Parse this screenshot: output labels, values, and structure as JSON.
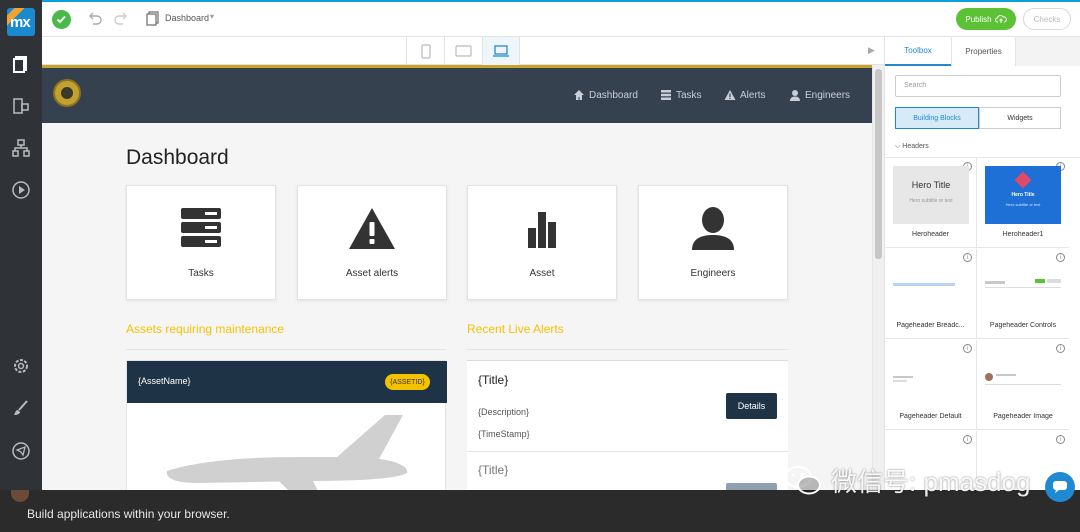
{
  "toolbar": {
    "doc_title": "Dashboard",
    "publish_label": "Publish",
    "checks_label": "Checks"
  },
  "logo": {
    "text": "mx",
    "ribbon": "beta"
  },
  "app": {
    "nav": [
      {
        "label": "Dashboard",
        "icon": "home-icon"
      },
      {
        "label": "Tasks",
        "icon": "server-icon"
      },
      {
        "label": "Alerts",
        "icon": "warning-icon"
      },
      {
        "label": "Engineers",
        "icon": "user-icon"
      }
    ],
    "page_title": "Dashboard",
    "tiles": [
      {
        "label": "Tasks",
        "icon": "server-icon"
      },
      {
        "label": "Asset alerts",
        "icon": "warning-icon"
      },
      {
        "label": "Asset",
        "icon": "bar-chart-icon"
      },
      {
        "label": "Engineers",
        "icon": "user-icon"
      }
    ],
    "sections": {
      "assets": "Assets requiring maintenance",
      "alerts": "Recent Live Alerts"
    },
    "asset_card": {
      "name": "{AssetName}",
      "id_badge": "{ASSETID}"
    },
    "alert_card": {
      "title": "{Title}",
      "description": "{Description}",
      "timestamp": "{TimeStamp}",
      "button": "Details",
      "title2": "{Title}"
    }
  },
  "toolbox": {
    "tabs": [
      "Toolbox",
      "Properties"
    ],
    "search_placeholder": "Search",
    "segments": [
      "Building Blocks",
      "Widgets"
    ],
    "group": "Headers",
    "widgets": [
      {
        "name": "Heroheader",
        "thumb_title": "Hero Title",
        "thumb_sub": "Hero subtitle or text"
      },
      {
        "name": "Heroheader1",
        "thumb_title": "Hero Title",
        "thumb_sub": "Hero subtitle or text"
      },
      {
        "name": "Pageheader Breadc..."
      },
      {
        "name": "Pageheader Controls"
      },
      {
        "name": "Pageheader Default"
      },
      {
        "name": "Pageheader Image"
      }
    ]
  },
  "caption": "Build applications within your browser.",
  "watermark": "微信号: pmasdog",
  "colors": {
    "accent": "#1f8ad2",
    "publish_green": "#5bc236",
    "nav_bg": "#364150",
    "gold": "#f5c200",
    "card_dark": "#1f3347"
  }
}
